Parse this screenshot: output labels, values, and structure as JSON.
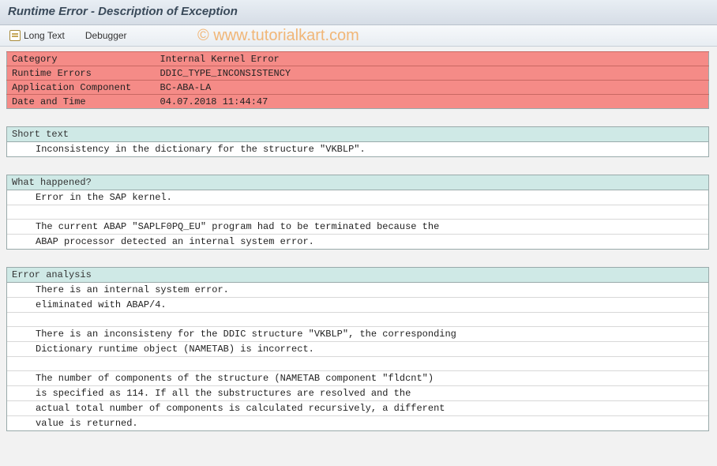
{
  "title": "Runtime Error - Description of Exception",
  "toolbar": {
    "long_text_label": "Long Text",
    "debugger_label": "Debugger"
  },
  "info": {
    "category_label": "Category",
    "category_value": "Internal Kernel Error",
    "runtime_errors_label": "Runtime Errors",
    "runtime_errors_value": "DDIC_TYPE_INCONSISTENCY",
    "application_component_label": "Application Component",
    "application_component_value": "BC-ABA-LA",
    "date_time_label": "Date and Time",
    "date_time_value": "04.07.2018 11:44:47"
  },
  "short_text": {
    "header": "Short text",
    "line1": "Inconsistency in the dictionary for the structure \"VKBLP\"."
  },
  "what_happened": {
    "header": "What happened?",
    "line1": "Error in the SAP kernel.",
    "line2": "",
    "line3": "The current ABAP \"SAPLF0PQ_EU\" program had to be terminated because the",
    "line4": "ABAP processor detected an internal system error."
  },
  "error_analysis": {
    "header": "Error analysis",
    "line1": "There is an internal system error.",
    "line2": "eliminated with ABAP/4.",
    "line3": "",
    "line4": "There is an inconsisteny for the DDIC structure \"VKBLP\", the corresponding",
    "line5": "Dictionary runtime object (NAMETAB) is incorrect.",
    "line6": "",
    "line7": "The number of components of the structure (NAMETAB component \"fldcnt\")",
    "line8": "is specified as 114. If all the substructures are resolved and the",
    "line9": "actual total number of components is calculated recursively, a different",
    "line10": "value is returned."
  },
  "watermark": "© www.tutorialkart.com"
}
